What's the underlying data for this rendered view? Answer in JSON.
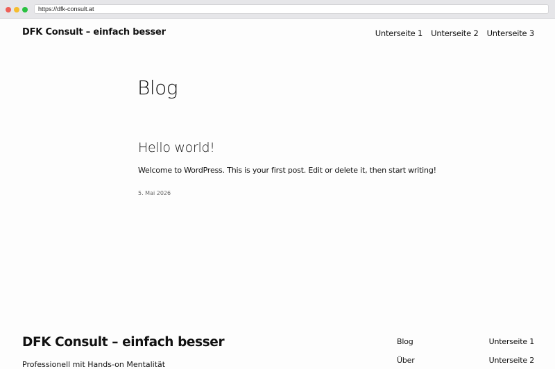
{
  "browser": {
    "url": "https://dfk-consult.at"
  },
  "header": {
    "site_title": "DFK Consult – einfach besser",
    "nav": [
      "Unterseite 1",
      "Unterseite 2",
      "Unterseite 3"
    ]
  },
  "main": {
    "page_title": "Blog",
    "posts": [
      {
        "title": "Hello world!",
        "excerpt": "Welcome to WordPress. This is your first post. Edit or delete it, then start writing!",
        "date": "5. Mai 2026"
      }
    ]
  },
  "footer": {
    "site_title": "DFK Consult – einfach besser",
    "tagline": "Professionell mit Hands-on Mentalität",
    "nav_left": [
      "Blog",
      "Über"
    ],
    "nav_right": [
      "Unterseite 1",
      "Unterseite 2"
    ]
  }
}
